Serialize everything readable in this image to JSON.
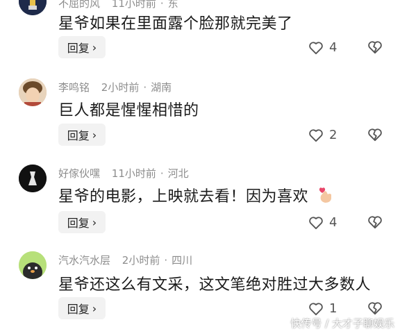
{
  "comments": [
    {
      "username": "不屈的风",
      "time": "11小时前",
      "location": "东",
      "text": "星爷如果在里面露个脸那就完美了",
      "reply_label": "回复",
      "likes": "4"
    },
    {
      "username": "李鸣铭",
      "time": "2小时前",
      "location": "湖南",
      "text": "巨人都是惺惺相惜的",
      "reply_label": "回复",
      "likes": "2"
    },
    {
      "username": "好傢伙嘿",
      "time": "11小时前",
      "location": "河北",
      "text": "星爷的电影，上映就去看！因为喜欢",
      "reply_label": "回复",
      "likes": "4"
    },
    {
      "username": "汽水汽水层",
      "time": "2小时前",
      "location": "四川",
      "text": "星爷还这么有文采，这文笔绝对胜过大多数人",
      "reply_label": "回复",
      "likes": "1"
    }
  ],
  "separator": "·",
  "watermark": "快传号 / 大才子聊娱乐",
  "icons": {
    "like": "heart-outline-icon",
    "dislike": "broken-heart-icon",
    "reply_chevron": "chevron-right-icon",
    "emoji": "finger-heart-emoji"
  }
}
